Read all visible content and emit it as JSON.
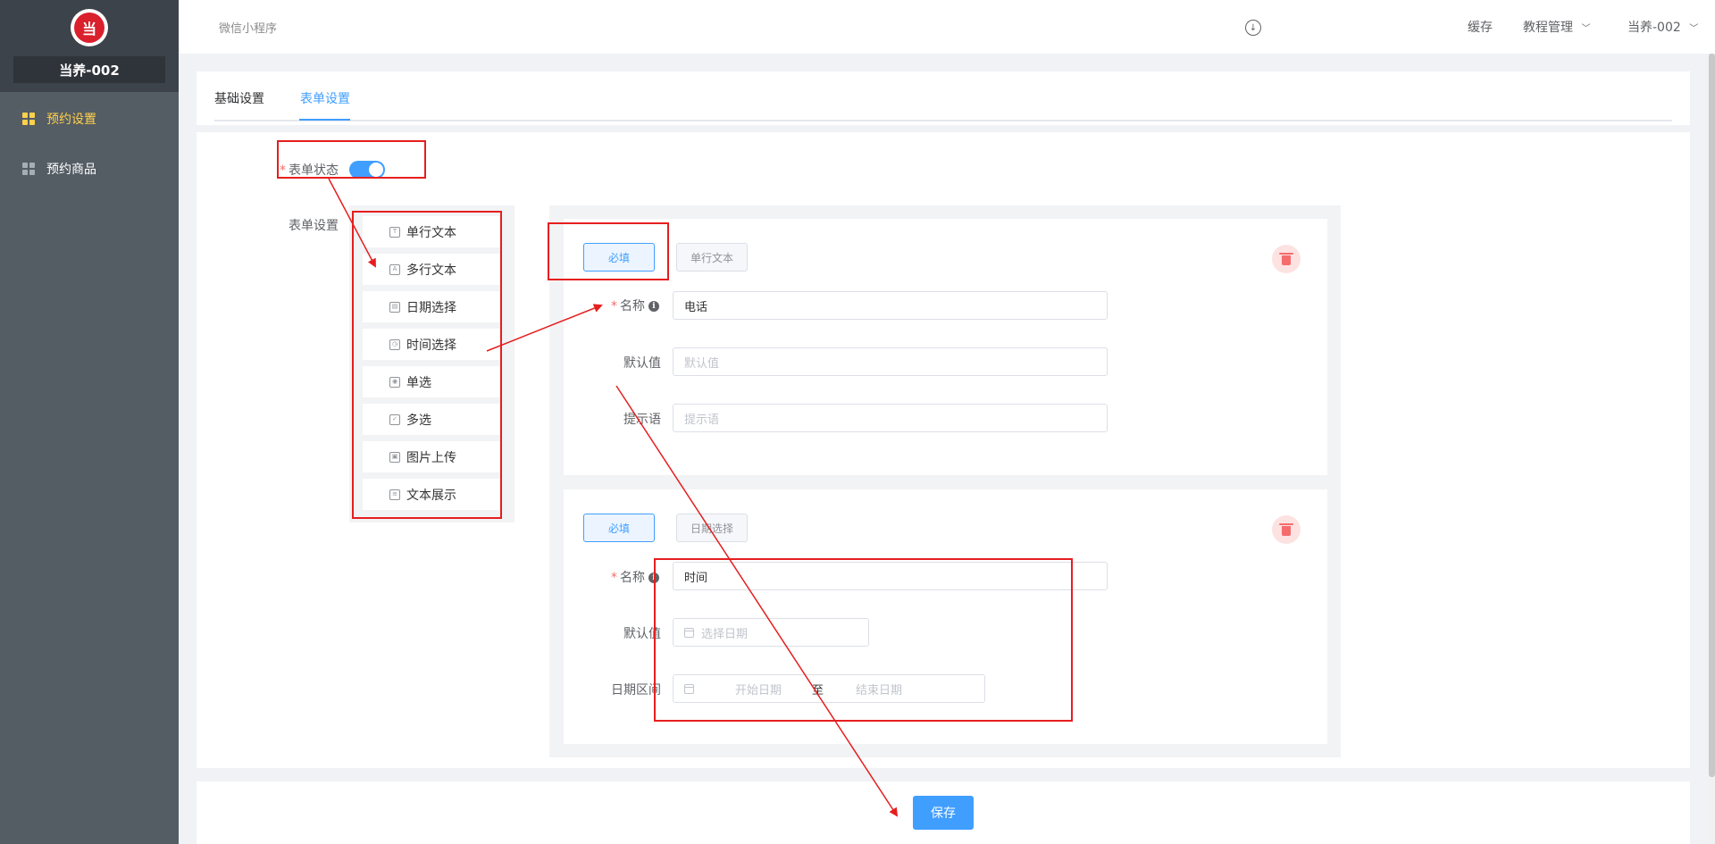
{
  "sidebar": {
    "logo_text": "当",
    "store_name": "当养-002",
    "items": [
      {
        "label": "预约设置",
        "active": true
      },
      {
        "label": "预约商品",
        "active": false
      }
    ]
  },
  "header": {
    "title": "微信小程序",
    "cache": "缓存",
    "tutorial": "教程管理",
    "user": "当养-002",
    "download_icon": "download-icon",
    "chevron_icon": "chevron-down-icon"
  },
  "tabs": [
    {
      "label": "基础设置",
      "active": false
    },
    {
      "label": "表单设置",
      "active": true
    }
  ],
  "form": {
    "status_label": "表单状态",
    "status_on": true,
    "settings_label": "表单设置",
    "palette": [
      "单行文本",
      "多行文本",
      "日期选择",
      "时间选择",
      "单选",
      "多选",
      "图片上传",
      "文本展示"
    ],
    "fields": [
      {
        "required_btn": "必填",
        "type_tag": "单行文本",
        "name_label": "名称",
        "name_value": "电话",
        "default_label": "默认值",
        "default_placeholder": "默认值",
        "hint_label": "提示语",
        "hint_placeholder": "提示语"
      },
      {
        "required_btn": "必填",
        "type_tag": "日期选择",
        "name_label": "名称",
        "name_value": "时间",
        "default_label": "默认值",
        "default_placeholder": "选择日期",
        "range_label": "日期区间",
        "range_start": "开始日期",
        "range_sep": "至",
        "range_end": "结束日期"
      }
    ],
    "save_label": "保存"
  },
  "colors": {
    "primary": "#409eff",
    "sidebar_bg": "#545c64",
    "active_menu": "#ffd04b",
    "annotation": "#e61e1e",
    "danger": "#f56c6c"
  }
}
